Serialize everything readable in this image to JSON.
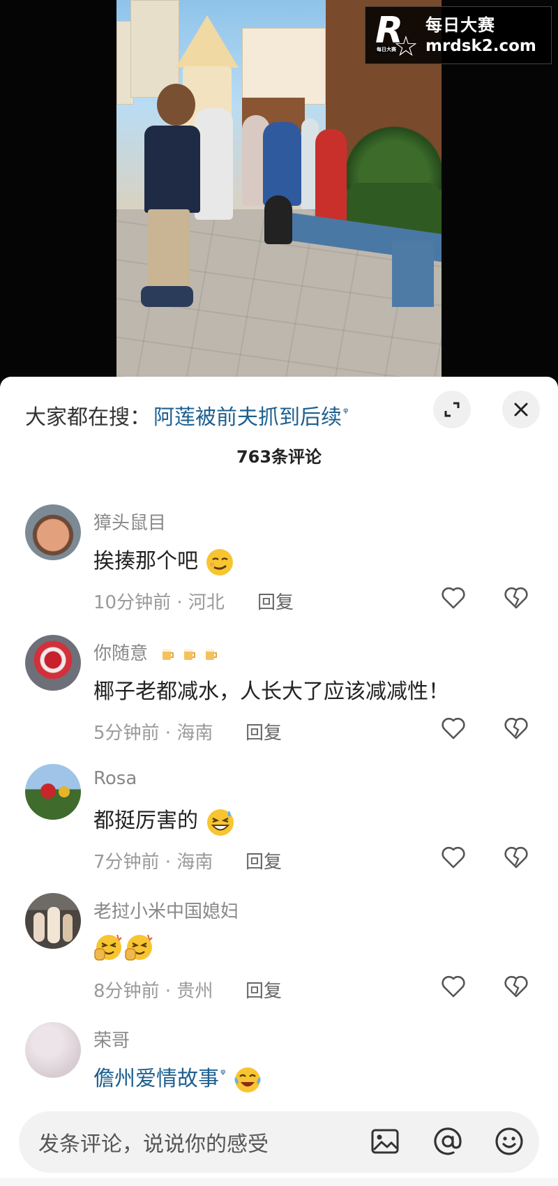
{
  "watermark": {
    "title": "每日大赛",
    "url": "mrdsk2.com",
    "logo_letter": "R",
    "logo_small": "每日大赛"
  },
  "sheet": {
    "search_prefix": "大家都在搜：",
    "search_link": "阿莲被前夫抓到后续",
    "search_icon": "ᵠ",
    "comment_count": "763条评论"
  },
  "comments": [
    {
      "username": "獐头鼠目",
      "text": "挨揍那个吧",
      "emoji": "smirk-face",
      "time": "10分钟前 · 河北",
      "reply": "回复"
    },
    {
      "username": "你随意",
      "badge": "beer-mugs",
      "text": "椰子老都减水，人长大了应该减减性！",
      "time": "5分钟前 · 海南",
      "reply": "回复"
    },
    {
      "username": "Rosa",
      "text": "都挺厉害的",
      "emoji": "grinning-sweat-face",
      "time": "7分钟前 · 海南",
      "reply": "回复"
    },
    {
      "username": "老挝小米中国媳妇",
      "text": "",
      "emoji": "applause-face x2",
      "time": "8分钟前 · 贵州",
      "reply": "回复"
    },
    {
      "username": "荣哥",
      "text": "儋州爱情故事",
      "text_is_link": true,
      "search_icon": "ᵠ",
      "emoji": "crying-laughing-face"
    }
  ],
  "input": {
    "placeholder": "发条评论，说说你的感受",
    "icons": [
      "image-icon",
      "at-icon",
      "emoji-icon"
    ]
  },
  "colors": {
    "link_blue": "#1d5f8f",
    "meta_gray": "#999999",
    "name_gray": "#888888",
    "sheet_bg": "#ffffff"
  }
}
